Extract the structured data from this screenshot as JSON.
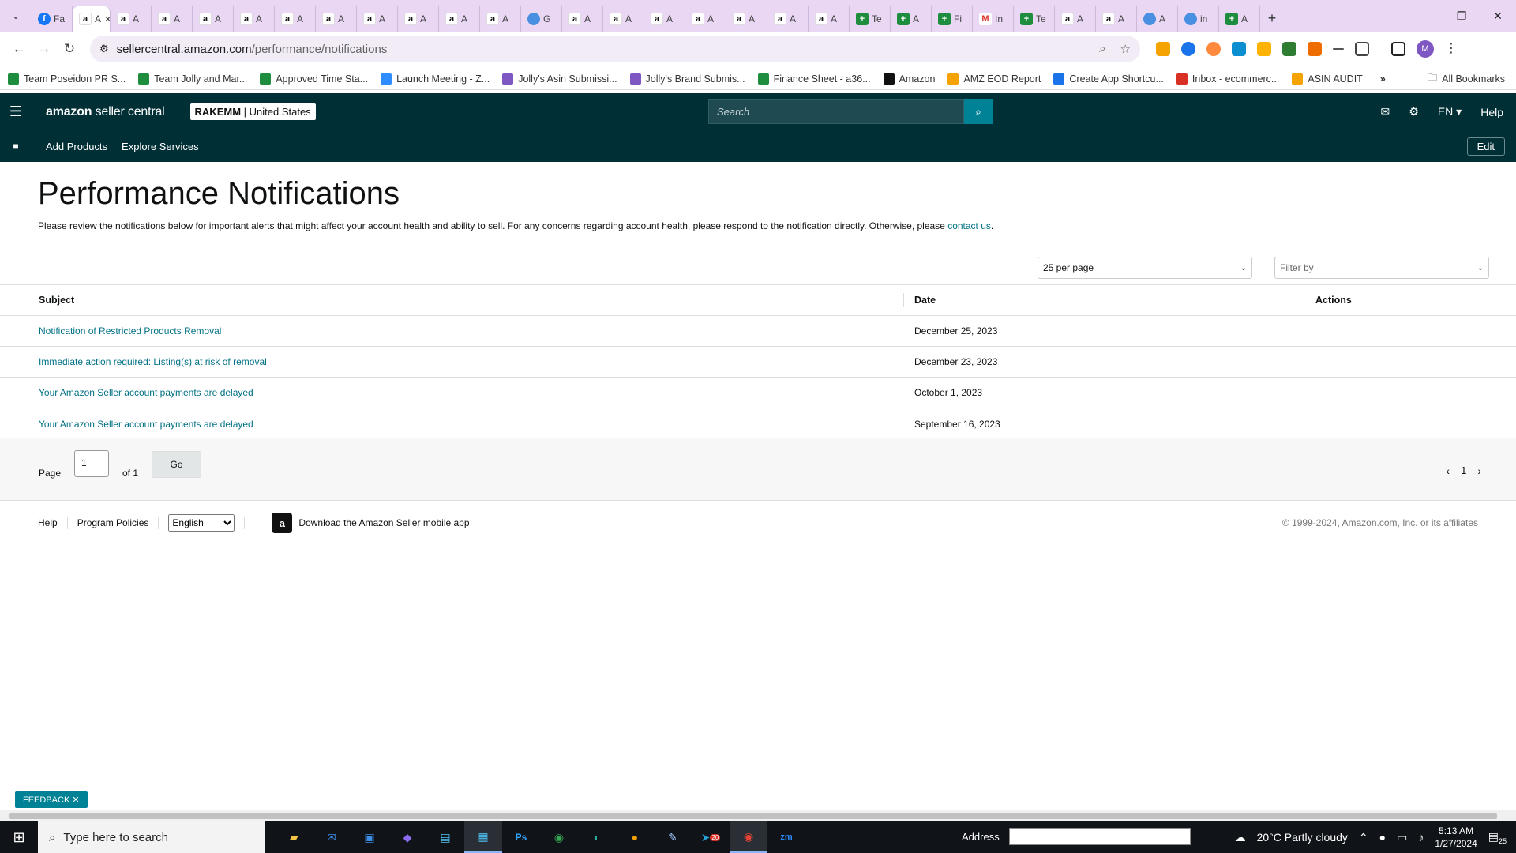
{
  "browser": {
    "tabs": [
      {
        "favicon": "fb",
        "label": "Fa",
        "active": false
      },
      {
        "favicon": "amz",
        "label": "A",
        "active": true
      },
      {
        "favicon": "amz",
        "label": "A",
        "active": false
      },
      {
        "favicon": "amz",
        "label": "A",
        "active": false
      },
      {
        "favicon": "amz",
        "label": "A",
        "active": false
      },
      {
        "favicon": "amz",
        "label": "A",
        "active": false
      },
      {
        "favicon": "amz",
        "label": "A",
        "active": false
      },
      {
        "favicon": "amz",
        "label": "A",
        "active": false
      },
      {
        "favicon": "amz",
        "label": "A",
        "active": false
      },
      {
        "favicon": "amz",
        "label": "A",
        "active": false
      },
      {
        "favicon": "amz",
        "label": "A",
        "active": false
      },
      {
        "favicon": "amz",
        "label": "A",
        "active": false
      },
      {
        "favicon": "misc",
        "label": "G",
        "active": false
      },
      {
        "favicon": "amz",
        "label": "A",
        "active": false
      },
      {
        "favicon": "amz",
        "label": "A",
        "active": false
      },
      {
        "favicon": "amz",
        "label": "A",
        "active": false
      },
      {
        "favicon": "amz",
        "label": "A",
        "active": false
      },
      {
        "favicon": "amz",
        "label": "A",
        "active": false
      },
      {
        "favicon": "amz",
        "label": "A",
        "active": false
      },
      {
        "favicon": "amz",
        "label": "A",
        "active": false
      },
      {
        "favicon": "sheet",
        "label": "Te",
        "active": false
      },
      {
        "favicon": "sheet",
        "label": "A",
        "active": false
      },
      {
        "favicon": "sheet",
        "label": "Fi",
        "active": false
      },
      {
        "favicon": "gm",
        "label": "In",
        "active": false
      },
      {
        "favicon": "sheet",
        "label": "Te",
        "active": false
      },
      {
        "favicon": "amz",
        "label": "A",
        "active": false
      },
      {
        "favicon": "amz",
        "label": "A",
        "active": false
      },
      {
        "favicon": "misc",
        "label": "A",
        "active": false
      },
      {
        "favicon": "misc",
        "label": "in",
        "active": false
      },
      {
        "favicon": "sheet",
        "label": "A",
        "active": false
      }
    ],
    "url_host": "sellercentral.amazon.com",
    "url_path": "/performance/notifications",
    "profile_initial": "M",
    "bookmarks": [
      {
        "label": "Team Poseidon PR S...",
        "color": "#1e8e3e"
      },
      {
        "label": "Team Jolly and Mar...",
        "color": "#1e8e3e"
      },
      {
        "label": "Approved Time Sta...",
        "color": "#1e8e3e"
      },
      {
        "label": "Launch Meeting - Z...",
        "color": "#2d8cff"
      },
      {
        "label": "Jolly's Asin Submissi...",
        "color": "#7e57c2"
      },
      {
        "label": "Jolly's Brand Submis...",
        "color": "#7e57c2"
      },
      {
        "label": "Finance Sheet - a36...",
        "color": "#1e8e3e"
      },
      {
        "label": "Amazon",
        "color": "#111111"
      },
      {
        "label": "AMZ EOD Report",
        "color": "#f4a300"
      },
      {
        "label": "Create App Shortcu...",
        "color": "#1a73e8"
      },
      {
        "label": "Inbox - ecommerc...",
        "color": "#d93025"
      },
      {
        "label": "ASIN AUDIT",
        "color": "#f4a300"
      }
    ],
    "all_bookmarks": "All Bookmarks"
  },
  "header": {
    "logo_bold": "amazon",
    "logo_rest": " seller central",
    "store_name": "RAKEMM",
    "store_region": "United States",
    "search_placeholder": "Search",
    "language": "EN",
    "help": "Help"
  },
  "subnav": {
    "links": [
      "Add Products",
      "Explore Services"
    ],
    "edit": "Edit"
  },
  "page": {
    "title": "Performance Notifications",
    "description": "Please review the notifications below for important alerts that might affect your account health and ability to sell. For any concerns regarding account health, please respond to the notification directly. Otherwise, please ",
    "contact_link": "contact us",
    "description_end": ".",
    "per_page": "25 per page",
    "filter_placeholder": "Filter by"
  },
  "table": {
    "headers": {
      "subject": "Subject",
      "date": "Date",
      "actions": "Actions"
    },
    "rows": [
      {
        "subject": "Notification of Restricted Products Removal",
        "date": "December 25, 2023"
      },
      {
        "subject": "Immediate action required: Listing(s) at risk of removal",
        "date": "December 23, 2023"
      },
      {
        "subject": "Your Amazon Seller account payments are delayed",
        "date": "October 1, 2023"
      },
      {
        "subject": "Your Amazon Seller account payments are delayed",
        "date": "September 16, 2023"
      }
    ]
  },
  "pager": {
    "page_label": "Page",
    "current": "1",
    "of_label": "of 1",
    "go": "Go",
    "page_num": "1"
  },
  "footer": {
    "help": "Help",
    "policies": "Program Policies",
    "language": "English",
    "app": "Download the Amazon Seller mobile app",
    "copyright": "© 1999-2024, Amazon.com, Inc. or its affiliates"
  },
  "feedback": "FEEDBACK",
  "taskbar": {
    "search_placeholder": "Type here to search",
    "address_label": "Address",
    "weather": "20°C  Partly cloudy",
    "time": "5:13 AM",
    "date": "1/27/2024",
    "notifications": "25",
    "chrome_badge": "20"
  }
}
